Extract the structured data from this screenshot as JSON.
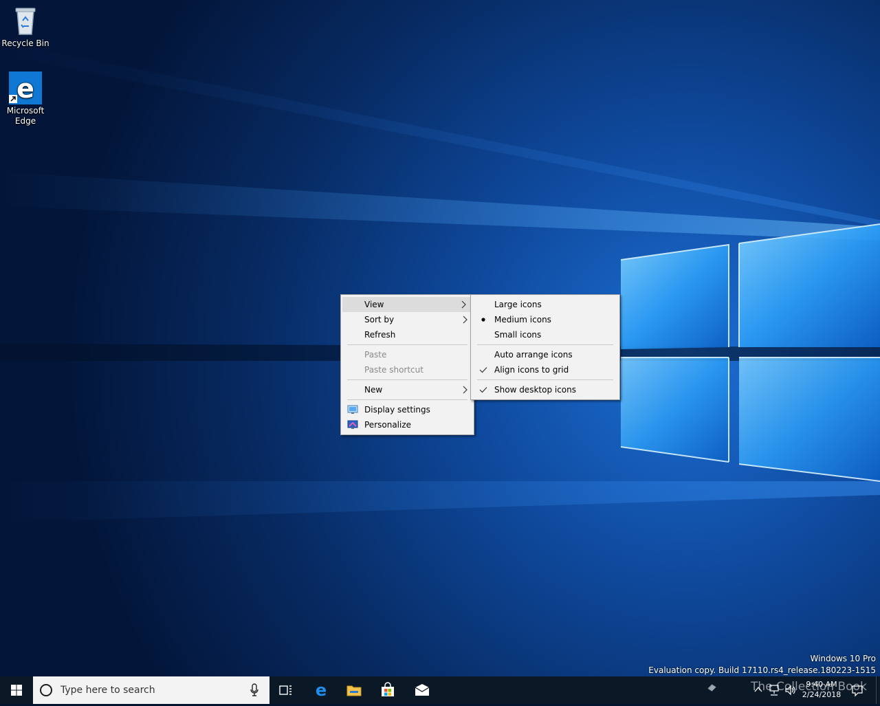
{
  "desktop": {
    "icons": [
      {
        "label": "Recycle Bin",
        "icon": "recycle-bin-icon"
      },
      {
        "label": "Microsoft Edge",
        "icon": "edge-icon"
      }
    ]
  },
  "context_menu": {
    "items": [
      {
        "label": "View",
        "has_submenu": true,
        "highlighted": true
      },
      {
        "label": "Sort by",
        "has_submenu": true
      },
      {
        "label": "Refresh"
      },
      {
        "label": "Paste",
        "disabled": true
      },
      {
        "label": "Paste shortcut",
        "disabled": true
      },
      {
        "label": "New",
        "has_submenu": true
      },
      {
        "label": "Display settings",
        "icon": "display-settings-icon"
      },
      {
        "label": "Personalize",
        "icon": "personalize-icon"
      }
    ]
  },
  "view_submenu": {
    "items": [
      {
        "label": "Large icons"
      },
      {
        "label": "Medium icons",
        "selected": true
      },
      {
        "label": "Small icons"
      },
      {
        "label": "Auto arrange icons",
        "checked": false
      },
      {
        "label": "Align icons to grid",
        "checked": true
      },
      {
        "label": "Show desktop icons",
        "checked": true
      }
    ]
  },
  "watermark": {
    "line1": "Windows 10 Pro",
    "line2": "Evaluation copy. Build 17110.rs4_release.180223-1515"
  },
  "taskbar": {
    "search_placeholder": "Type here to search",
    "pinned": [
      "task-view-icon",
      "edge-icon",
      "file-explorer-icon",
      "store-icon",
      "mail-icon"
    ],
    "clock": {
      "time": "9:40 AM",
      "date": "2/24/2018"
    },
    "overlay_text": "The Collection Book"
  },
  "colors": {
    "menu_bg": "#f2f2f2",
    "menu_highlight": "#dcdcdc",
    "taskbar_bg": "#0b1826",
    "wallpaper_accent": "#3aa6ff"
  }
}
